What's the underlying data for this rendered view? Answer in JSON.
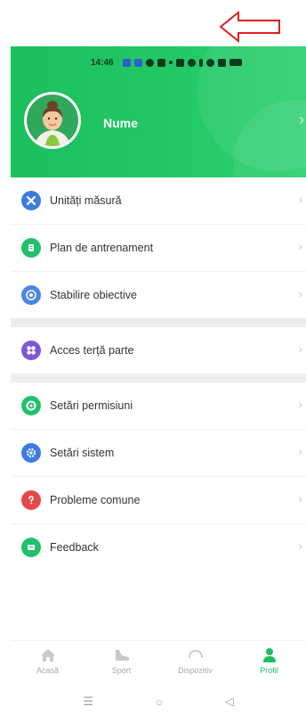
{
  "status_bar": {
    "time": "14:46"
  },
  "profile": {
    "name": "Nume",
    "chevron": "›"
  },
  "menu": {
    "groups": [
      {
        "items": [
          {
            "label": "Unități măsură",
            "icon": "ruler-icon",
            "color": "#3d7be0"
          },
          {
            "label": "Plan de antrenament",
            "icon": "plan-icon",
            "color": "#22c06b"
          },
          {
            "label": "Stabilire obiective",
            "icon": "target-icon",
            "color": "#4a86e8"
          }
        ]
      },
      {
        "items": [
          {
            "label": "Acces terță parte",
            "icon": "third-party-icon",
            "color": "#7f55d6"
          }
        ]
      },
      {
        "items": [
          {
            "label": "Setări permisiuni",
            "icon": "permissions-icon",
            "color": "#22c06b"
          },
          {
            "label": "Setări sistem",
            "icon": "system-settings-icon",
            "color": "#3d7be0"
          },
          {
            "label": "Probleme comune",
            "icon": "question-icon",
            "color": "#e64848"
          },
          {
            "label": "Feedback",
            "icon": "feedback-icon",
            "color": "#22c06b"
          }
        ]
      }
    ],
    "chevron": "›"
  },
  "tabbar": {
    "tabs": [
      {
        "label": "Acasă",
        "icon": "home-icon",
        "active": false
      },
      {
        "label": "Sport",
        "icon": "sport-shoe-icon",
        "active": false
      },
      {
        "label": "Dispozitiv",
        "icon": "watch-icon",
        "active": false
      },
      {
        "label": "Profil",
        "icon": "profile-icon",
        "active": true
      }
    ]
  },
  "navbar": {
    "menu": "☰",
    "home": "○",
    "back": "◁"
  },
  "colors": {
    "accent": "#1fbf5e",
    "annotation": "#e02020"
  }
}
